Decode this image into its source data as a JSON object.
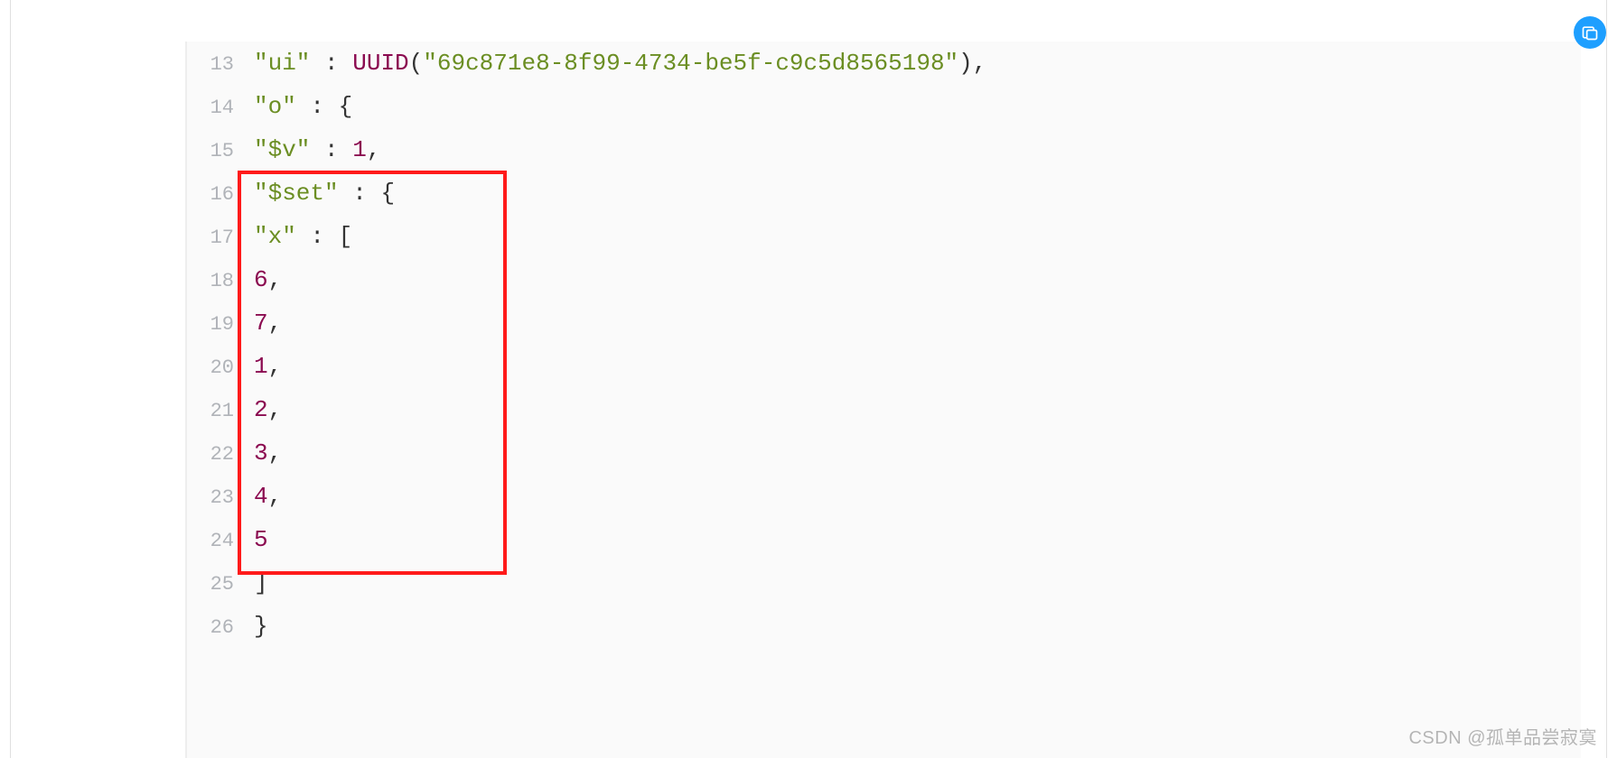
{
  "watermark": "CSDN @孤单品尝寂寞",
  "lines": [
    {
      "n": "13",
      "seg": [
        {
          "t": "\"ui\"",
          "c": "str"
        },
        {
          "t": " : ",
          "c": "punc"
        },
        {
          "t": "UUID",
          "c": "func"
        },
        {
          "t": "(",
          "c": "punc"
        },
        {
          "t": "\"69c871e8-8f99-4734-be5f-c9c5d8565198\"",
          "c": "str"
        },
        {
          "t": ")",
          "c": "punc"
        },
        {
          "t": ",",
          "c": "comma"
        }
      ]
    },
    {
      "n": "14",
      "seg": [
        {
          "t": "\"o\"",
          "c": "str"
        },
        {
          "t": " : ",
          "c": "punc"
        },
        {
          "t": "{",
          "c": "punc"
        }
      ]
    },
    {
      "n": "15",
      "seg": [
        {
          "t": "\"$v\"",
          "c": "str"
        },
        {
          "t": " : ",
          "c": "punc"
        },
        {
          "t": "1",
          "c": "num"
        },
        {
          "t": ",",
          "c": "comma"
        }
      ]
    },
    {
      "n": "16",
      "seg": [
        {
          "t": "\"$set\"",
          "c": "str"
        },
        {
          "t": " : ",
          "c": "punc"
        },
        {
          "t": "{",
          "c": "punc"
        }
      ]
    },
    {
      "n": "17",
      "seg": [
        {
          "t": "\"x\"",
          "c": "str"
        },
        {
          "t": " : ",
          "c": "punc"
        },
        {
          "t": "[",
          "c": "punc"
        }
      ]
    },
    {
      "n": "18",
      "seg": [
        {
          "t": "6",
          "c": "num"
        },
        {
          "t": ",",
          "c": "comma"
        }
      ]
    },
    {
      "n": "19",
      "seg": [
        {
          "t": "7",
          "c": "num"
        },
        {
          "t": ",",
          "c": "comma"
        }
      ]
    },
    {
      "n": "20",
      "seg": [
        {
          "t": "1",
          "c": "num"
        },
        {
          "t": ",",
          "c": "comma"
        }
      ]
    },
    {
      "n": "21",
      "seg": [
        {
          "t": "2",
          "c": "num"
        },
        {
          "t": ",",
          "c": "comma"
        }
      ]
    },
    {
      "n": "22",
      "seg": [
        {
          "t": "3",
          "c": "num"
        },
        {
          "t": ",",
          "c": "comma"
        }
      ]
    },
    {
      "n": "23",
      "seg": [
        {
          "t": "4",
          "c": "num"
        },
        {
          "t": ",",
          "c": "comma"
        }
      ]
    },
    {
      "n": "24",
      "seg": [
        {
          "t": "5",
          "c": "num"
        }
      ]
    },
    {
      "n": "25",
      "seg": [
        {
          "t": "]",
          "c": "punc"
        }
      ]
    },
    {
      "n": "26",
      "seg": [
        {
          "t": "}",
          "c": "punc"
        }
      ]
    }
  ]
}
